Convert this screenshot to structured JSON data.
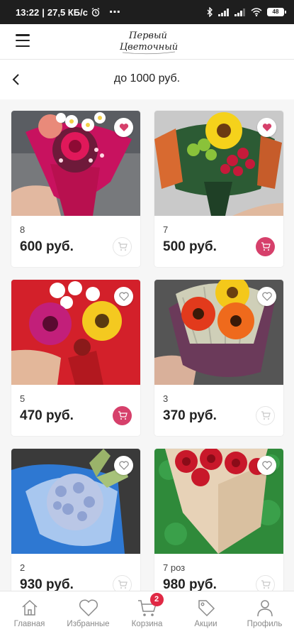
{
  "status_bar": {
    "time": "13:22",
    "separator": "|",
    "speed": "27,5 КБ/с",
    "dots": "⋯",
    "battery": "48"
  },
  "header": {
    "logo_line1": "Первый",
    "logo_line2": "Цветочный"
  },
  "title_bar": {
    "title": "до 1000 руб."
  },
  "products": [
    {
      "qty": "8",
      "price": "600 руб.",
      "favorited": true,
      "in_cart": false
    },
    {
      "qty": "7",
      "price": "500 руб.",
      "favorited": true,
      "in_cart": true
    },
    {
      "qty": "5",
      "price": "470 руб.",
      "favorited": false,
      "in_cart": true
    },
    {
      "qty": "3",
      "price": "370 руб.",
      "favorited": false,
      "in_cart": false
    },
    {
      "qty": "2",
      "price": "930 руб.",
      "favorited": false,
      "in_cart": false
    },
    {
      "qty": "7 роз",
      "price": "980 руб.",
      "favorited": false,
      "in_cart": false
    }
  ],
  "bottom_nav": {
    "items": [
      {
        "label": "Главная",
        "icon": "home-icon"
      },
      {
        "label": "Избранные",
        "icon": "heart-icon"
      },
      {
        "label": "Корзина",
        "icon": "cart-icon",
        "badge": "2"
      },
      {
        "label": "Акции",
        "icon": "tag-icon"
      },
      {
        "label": "Профиль",
        "icon": "profile-icon"
      }
    ]
  },
  "colors": {
    "accent": "#d6406b",
    "badge": "#e02844",
    "status_bar": "#1e1e1e"
  }
}
